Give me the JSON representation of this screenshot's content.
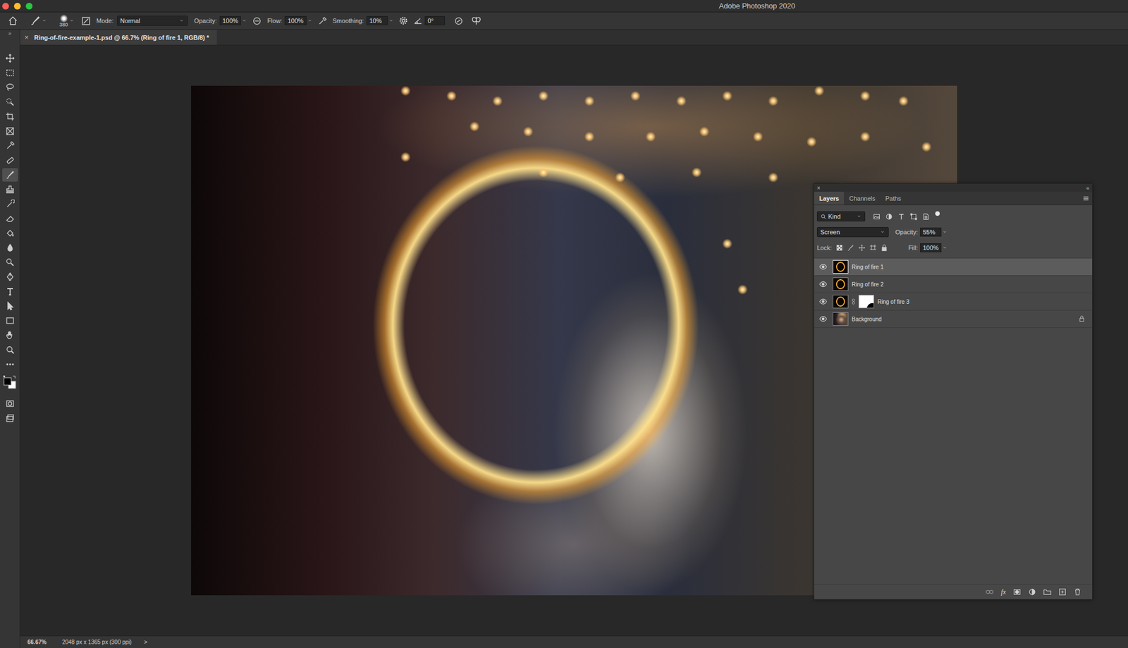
{
  "window": {
    "title": "Adobe Photoshop 2020"
  },
  "options_bar": {
    "brush_size": "380",
    "mode_label": "Mode:",
    "mode": "Normal",
    "opacity_label": "Opacity:",
    "opacity": "100%",
    "flow_label": "Flow:",
    "flow": "100%",
    "smoothing_label": "Smoothing:",
    "smoothing": "10%",
    "angle": "0°"
  },
  "toolbar": {
    "expand": "»",
    "tools": [
      {
        "selected": false
      },
      {
        "selected": false
      },
      {
        "selected": false
      },
      {
        "selected": false
      },
      {
        "selected": false
      },
      {
        "selected": false
      },
      {
        "selected": false
      },
      {
        "selected": false
      },
      {
        "selected": true
      },
      {
        "selected": false
      },
      {
        "selected": false
      },
      {
        "selected": false
      },
      {
        "selected": false
      },
      {
        "selected": false
      },
      {
        "selected": false
      },
      {
        "selected": false
      },
      {
        "selected": false
      },
      {
        "selected": false
      },
      {
        "selected": false
      },
      {
        "selected": false
      },
      {
        "selected": false
      },
      {
        "selected": false
      }
    ]
  },
  "document_tab": {
    "close": "×",
    "title": "Ring-of-fire-example-1.psd @ 66.7% (Ring of fire 1, RGB/8) *"
  },
  "layers_panel": {
    "close": "×",
    "collapse": "«",
    "tabs": [
      {
        "label": "Layers",
        "selected": true
      },
      {
        "label": "Channels",
        "selected": false
      },
      {
        "label": "Paths",
        "selected": false
      }
    ],
    "filter": "Kind",
    "blend_mode": "Screen",
    "opacity_label": "Opacity:",
    "opacity": "55%",
    "lock_label": "Lock:",
    "fill_label": "Fill:",
    "fill": "100%",
    "layers": [
      {
        "name": "Ring of fire 1",
        "kind": "ring",
        "visible": true,
        "selected": true,
        "has_mask": false,
        "locked": false
      },
      {
        "name": "Ring of fire 2",
        "kind": "ring",
        "visible": true,
        "selected": false,
        "has_mask": false,
        "locked": false
      },
      {
        "name": "Ring of fire 3",
        "kind": "ring",
        "visible": true,
        "selected": false,
        "has_mask": true,
        "locked": false
      },
      {
        "name": "Background",
        "kind": "photo",
        "visible": true,
        "selected": false,
        "has_mask": false,
        "locked": true
      }
    ],
    "footer_fx": "fx"
  },
  "status_bar": {
    "zoom": "66.67%",
    "doc_info": "2048 px x 1365 px (300 ppi)",
    "arrow": ">"
  }
}
